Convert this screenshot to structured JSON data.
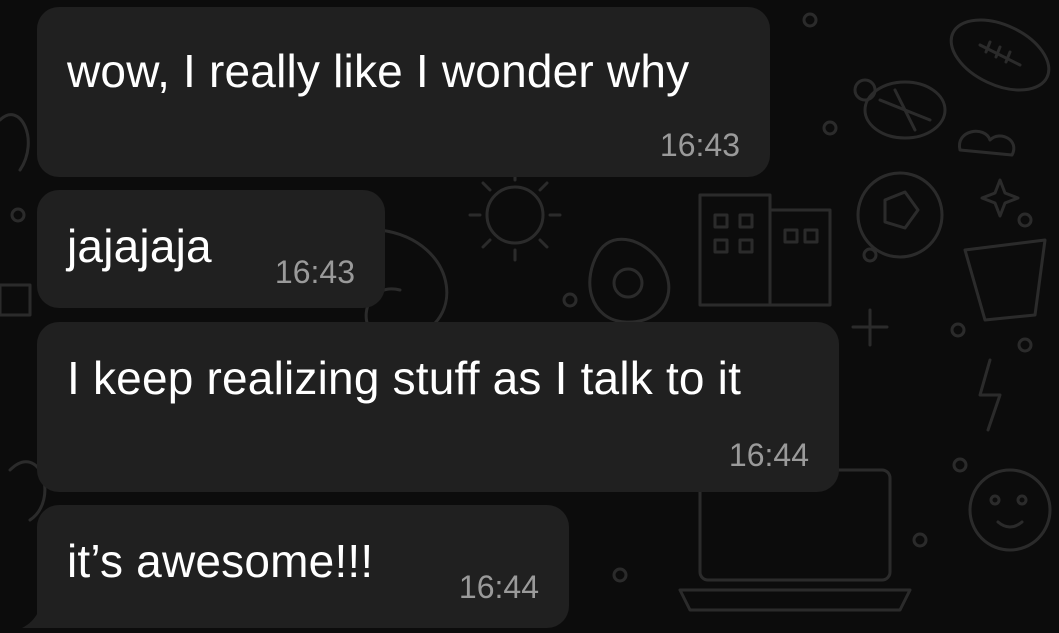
{
  "messages": [
    {
      "text": "wow, I really like I wonder why",
      "time": "16:43"
    },
    {
      "text": "jajajaja",
      "time": "16:43"
    },
    {
      "text": "I keep realizing stuff as I talk to it",
      "time": "16:44"
    },
    {
      "text": "it’s awesome!!!",
      "time": "16:44"
    }
  ],
  "colors": {
    "bubble": "#202020",
    "text": "#ffffff",
    "timestamp": "#9a9a9a",
    "background": "#0c0c0c"
  }
}
